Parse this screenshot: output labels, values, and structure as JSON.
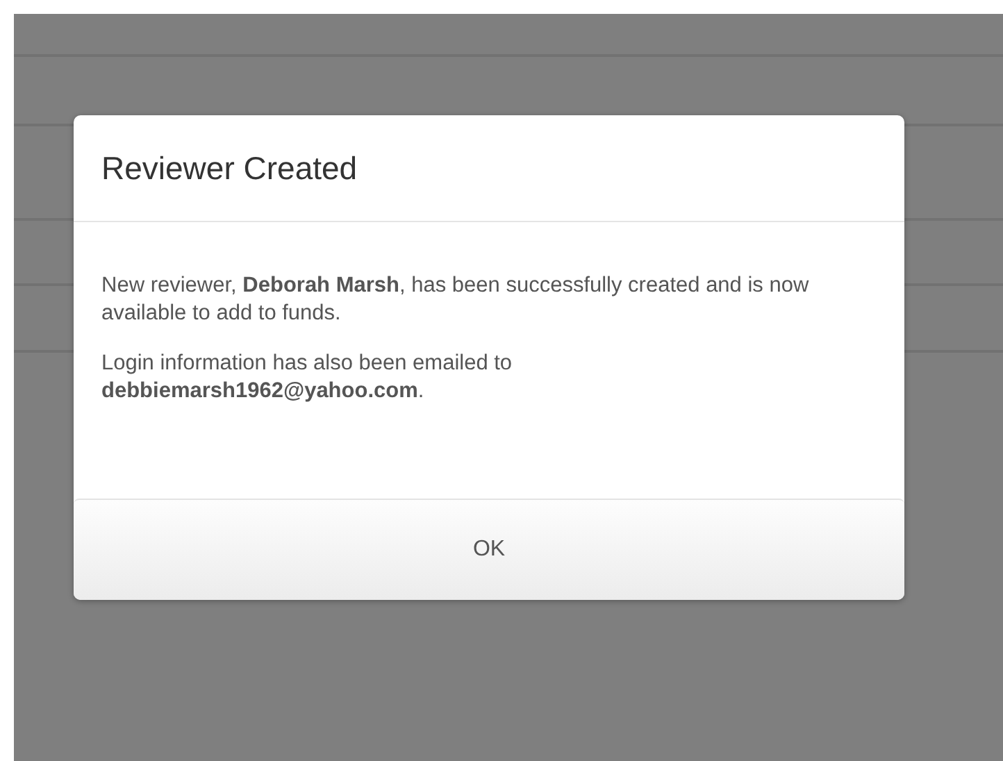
{
  "dialog": {
    "title": "Reviewer Created",
    "paragraphs": [
      "New reviewer, **Deborah Marsh**, has been successfully created and is now available to add to funds.",
      "Login information has also been emailed to **debbiemarsh1962@yahoo.com**."
    ],
    "buttons": [
      "OK"
    ]
  }
}
